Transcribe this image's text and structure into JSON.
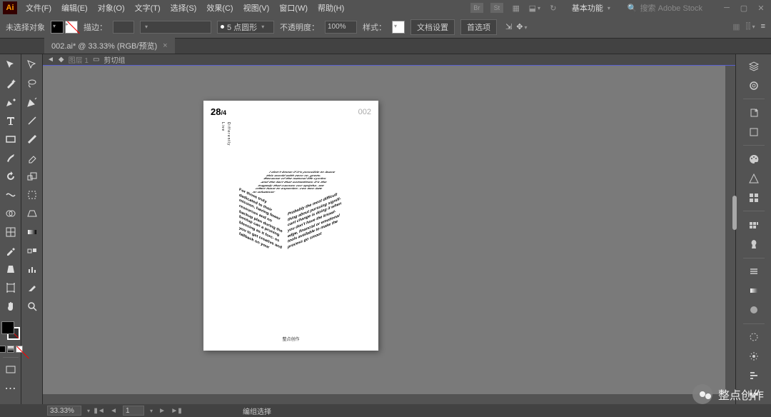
{
  "app": {
    "logo": "Ai"
  },
  "menu": {
    "items": [
      "文件(F)",
      "编辑(E)",
      "对象(O)",
      "文字(T)",
      "选择(S)",
      "效果(C)",
      "视图(V)",
      "窗口(W)",
      "帮助(H)"
    ],
    "br_badge": "Br",
    "st_badge": "St",
    "workspace": "基本功能",
    "search_placeholder": "搜索 Adobe Stock"
  },
  "control": {
    "no_selection": "未选择对象",
    "stroke_label": "描边：",
    "brush_value": "5 点圆形",
    "opacity_label": "不透明度：",
    "opacity_value": "100%",
    "style_label": "样式：",
    "doc_setup": "文档设置",
    "prefs": "首选项"
  },
  "tab": {
    "title": "002.ai* @ 33.33% (RGB/预览)"
  },
  "breadcrumb": {
    "layer": "图层 1",
    "clip": "剪切组"
  },
  "artboard": {
    "date_main": "28",
    "date_sub": "/4",
    "number": "002",
    "vtext1": "Live",
    "vtext2": "Differently",
    "cube_top": "I don't know if it's possible to leave this world with zero re- grets. Because of the natural life cycles and the fact that sometimes it's the tragedy that causes our epipha- we often have to experien- ces two late to whatever",
    "cube_left": "For those truly dedicated to their mission, having fewer resources and no backup plan during the bootup can a pruning blessing as it forc- es you to get creative and fallback on your",
    "cube_right": "Probably the most difficult thing about pursuing signifi- cant change is doing it when you don't have the knowl- edge, financial or emotional tools available to make the process go smoot",
    "footer": "整点创作"
  },
  "status": {
    "zoom": "33.33%",
    "page": "1",
    "mode": "编组选择"
  },
  "watermark": {
    "text": "整点创作"
  }
}
